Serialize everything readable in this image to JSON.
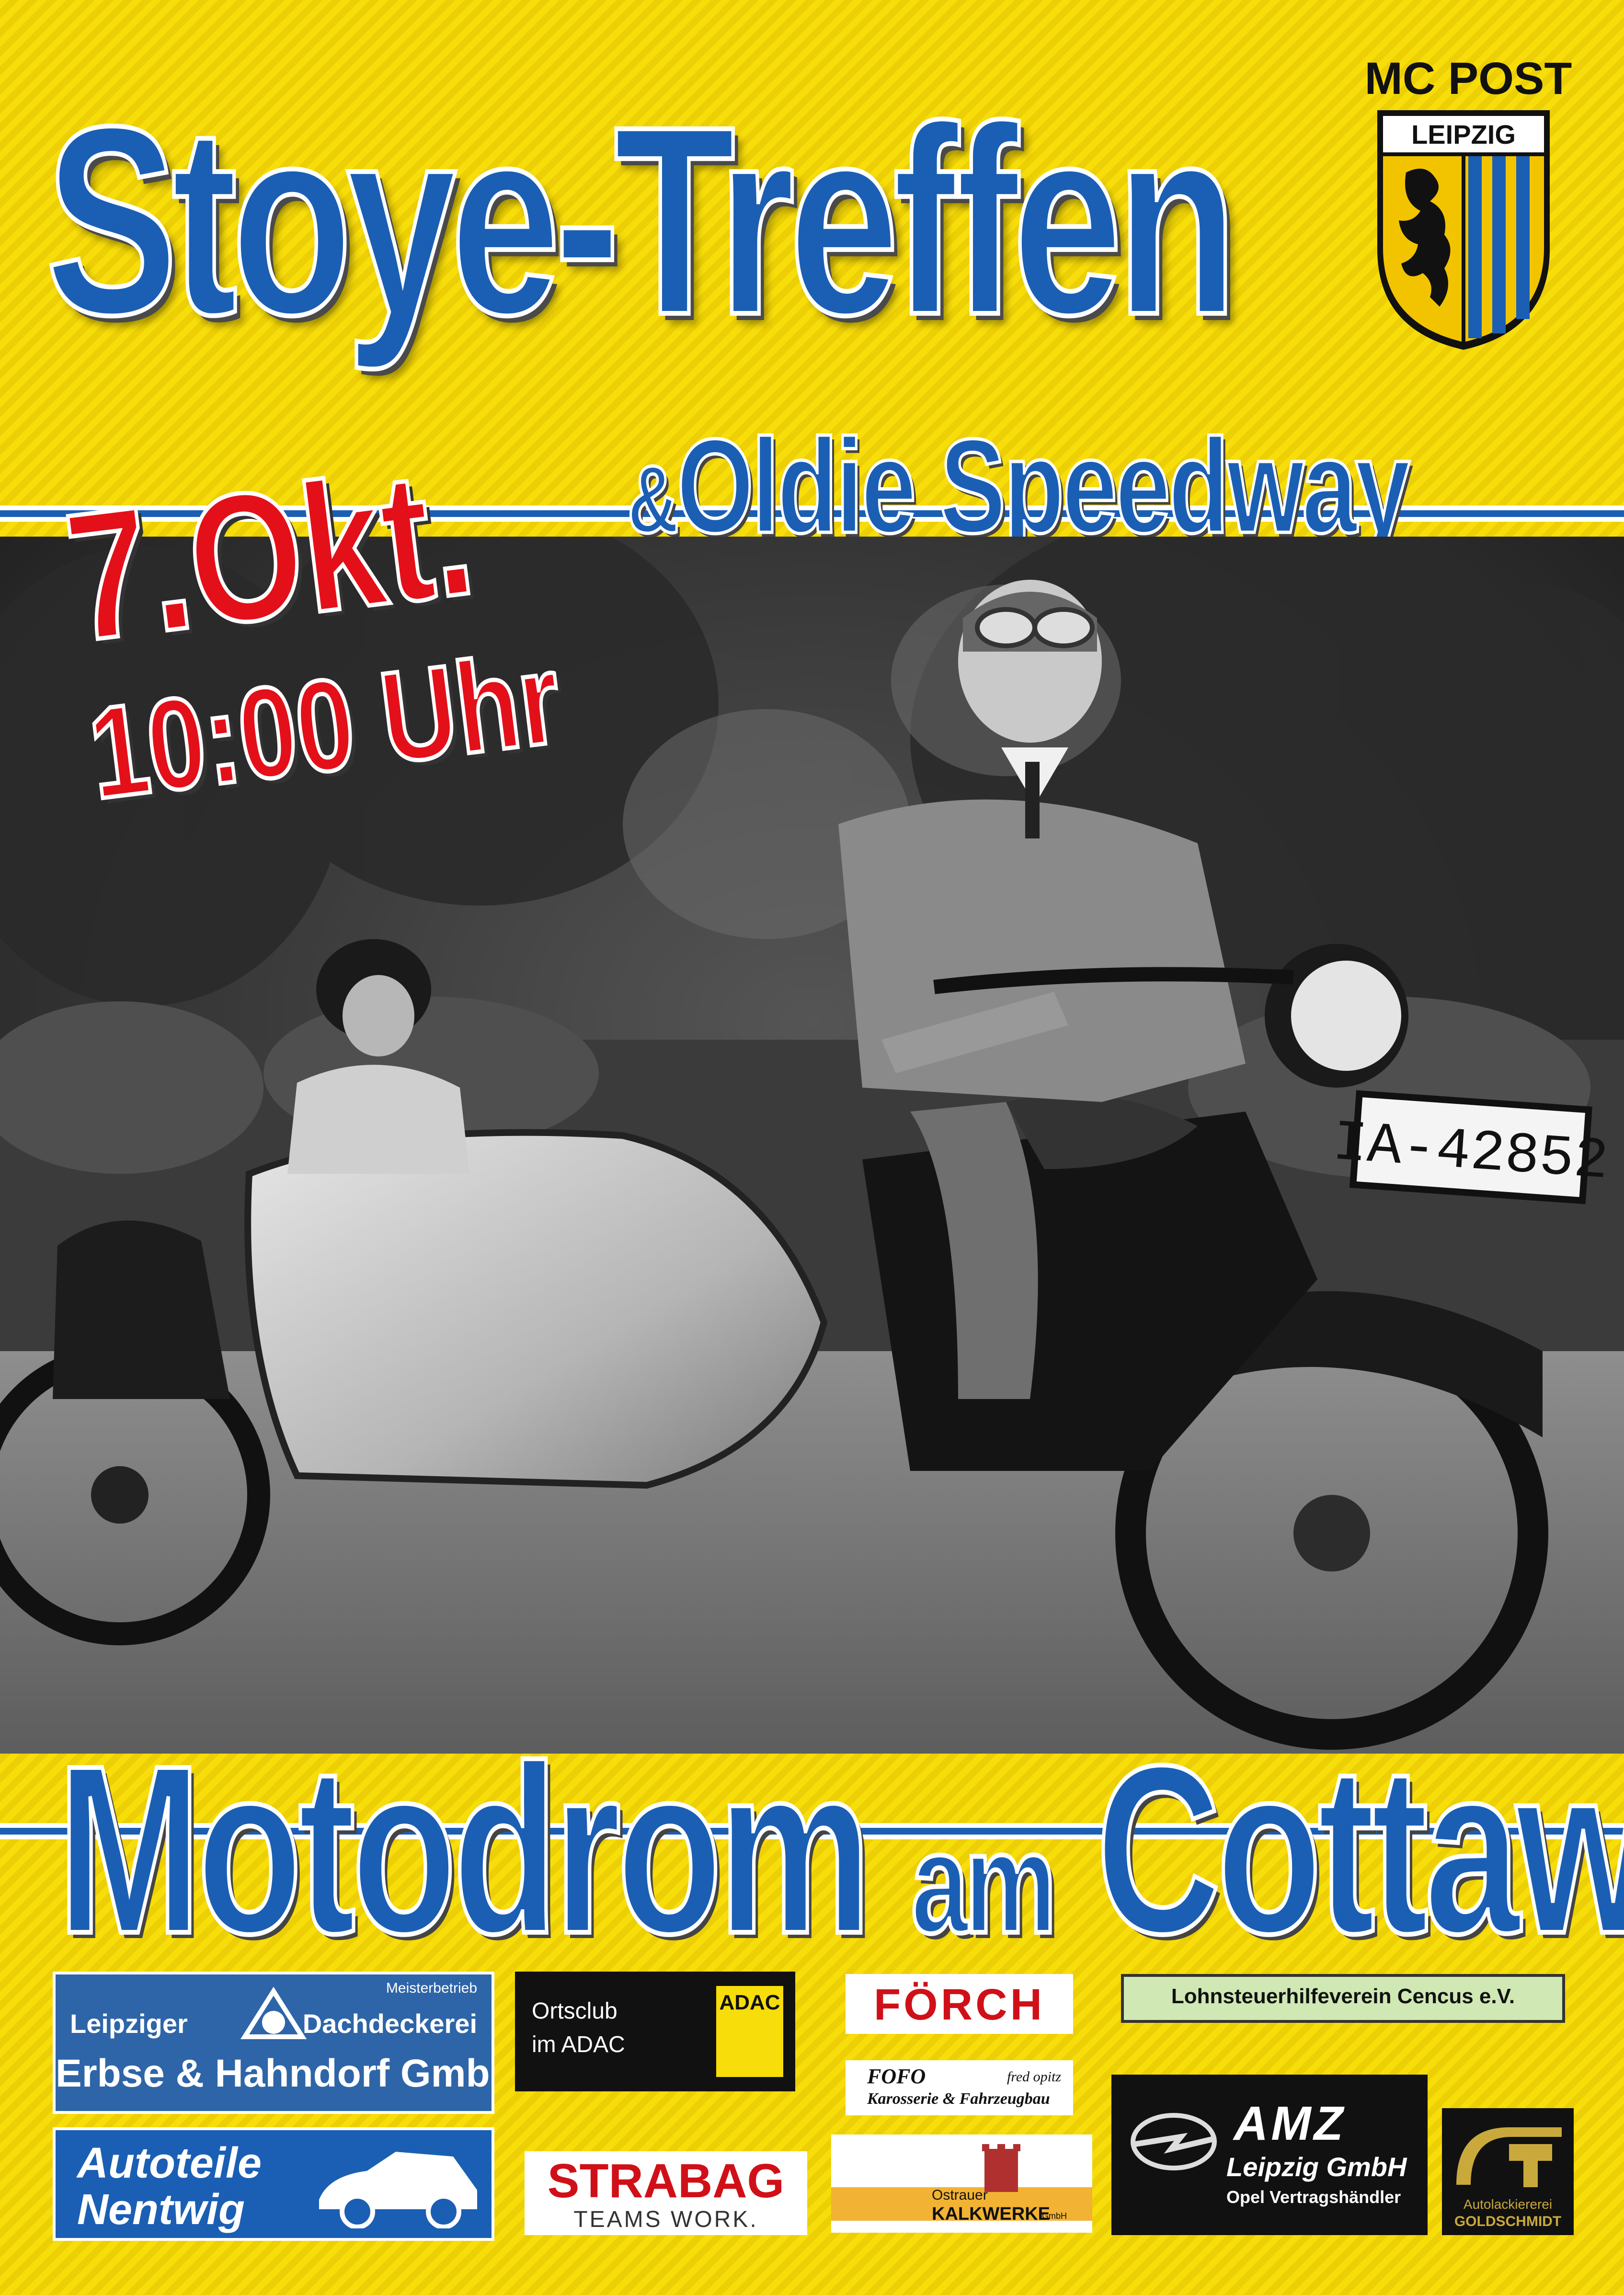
{
  "title": "Stoye-Treffen",
  "subtitle_amp": "&",
  "subtitle": "Oldie Speedway",
  "date": "7.Okt.",
  "time": "10:00 Uhr",
  "venue_part1": "Motodrom",
  "venue_part2": "am",
  "venue_part3": "Cottaweg",
  "club": {
    "name": "MC POST",
    "city": "LEIPZIG"
  },
  "photo": {
    "license_plate": "IA-42852"
  },
  "sponsors": {
    "dachdecker": {
      "line_small": "Meisterbetrieb",
      "left": "Leipziger",
      "right": "Dachdeckerei",
      "name": "Erbse & Hahndorf GmbH"
    },
    "adac": {
      "line1": "Ortsclub",
      "line2": "im ADAC",
      "badge": "ADAC"
    },
    "forch": {
      "name": "FÖRCH"
    },
    "lohnsteuer": {
      "name": "Lohnsteuerhilfeverein Cencus e.V."
    },
    "fofo": {
      "brand": "FOFO",
      "owner": "fred opitz",
      "tagline": "Karosserie & Fahrzeugbau"
    },
    "amz": {
      "brand": "AMZ",
      "line2": "Leipzig GmbH",
      "line3": "Opel Vertragshändler"
    },
    "autoteile": {
      "line1": "Autoteile",
      "line2": "Nentwig"
    },
    "strabag": {
      "brand": "STRABAG",
      "tagline": "TEAMS WORK."
    },
    "kalkwerke": {
      "line1": "Ostrauer",
      "line2": "KALKWERKE",
      "suffix": "GmbH"
    },
    "goldschmidt": {
      "line1": "Autolackiererei",
      "line2": "GOLDSCHMIDT"
    }
  },
  "colors": {
    "yellow": "#f7dd0a",
    "blue": "#1a5fb4",
    "red": "#e3101a"
  }
}
